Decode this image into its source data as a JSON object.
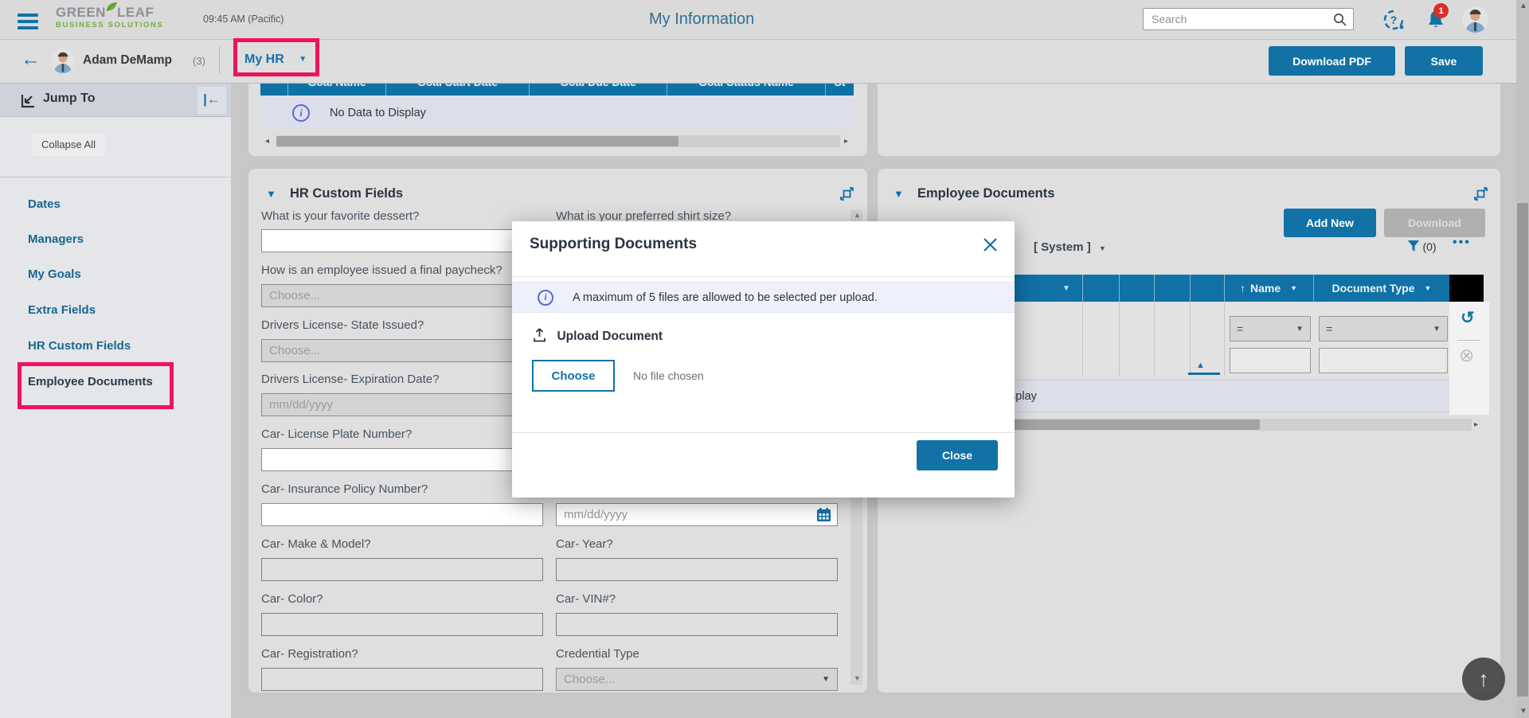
{
  "colors": {
    "primary_blue": "#1272a6",
    "table_header_blue": "#1071a6",
    "link_blue": "#1b6d99",
    "page_background": "#c7c7c7",
    "panel_background": "#dfdfdf",
    "empty_row_background": "#dcdfe9",
    "info_banner_background": "#eef1fb",
    "annotation_red": "#f0135c",
    "notification_badge_red": "#d93025",
    "disabled_button_gray": "#b0b0b0"
  },
  "topbar": {
    "logo_green": "GREEN",
    "logo_leaf": "LEAF",
    "logo_tagline": "BUSINESS SOLUTIONS",
    "time": "09:45 AM (Pacific)",
    "page_title": "My Information",
    "search_placeholder": "Search",
    "notification_count": "1"
  },
  "toolbar": {
    "employee_name": "Adam DeMamp",
    "employee_suffix": "(3)",
    "nav_menu_label": "My HR",
    "download_pdf_label": "Download PDF",
    "save_label": "Save"
  },
  "sidebar": {
    "header": "Jump To",
    "collapse_all_label": "Collapse All",
    "items": [
      "Dates",
      "Managers",
      "My Goals",
      "Extra Fields",
      "HR Custom Fields",
      "Employee Documents"
    ]
  },
  "goals": {
    "columns": [
      "Goal Name",
      "Goal Start Date",
      "Goal Due Date",
      "Goal Status Name",
      "St"
    ],
    "empty_message": "No Data to Display"
  },
  "hr": {
    "title": "HR Custom Fields",
    "choose_placeholder": "Choose...",
    "date_placeholder": "mm/dd/yyyy",
    "left": [
      {
        "label": "What is your favorite dessert?"
      },
      {
        "label": "How is an employee issued a final paycheck?"
      },
      {
        "label": "Drivers License- State Issued?"
      },
      {
        "label": "Drivers License- Expiration Date?"
      },
      {
        "label": "Car- License Plate Number?"
      },
      {
        "label": "Car- Insurance Policy Number?"
      },
      {
        "label": "Car- Make & Model?"
      },
      {
        "label": "Car- Color?"
      },
      {
        "label": "Car- Registration?"
      }
    ],
    "right": [
      {
        "label": "What is your preferred shirt size?"
      },
      {
        "label": "Car- Year?"
      },
      {
        "label": "Car- VIN#?"
      },
      {
        "label": "Credential Type"
      }
    ]
  },
  "documents": {
    "title": "Employee Documents",
    "add_new_label": "Add New",
    "download_label": "Download",
    "view_dropdown": "[ System ]",
    "filter_count": "(0)",
    "sort_arrow": "↑",
    "name_column": "Name",
    "type_column": "Document Type",
    "filter_operator": "=",
    "empty_message": "No Data to Display"
  },
  "modal": {
    "title": "Supporting Documents",
    "info_message": "A maximum of 5 files are allowed to be selected per upload.",
    "upload_section_label": "Upload Document",
    "choose_button_label": "Choose",
    "no_file_label": "No file chosen",
    "close_button_label": "Close"
  }
}
